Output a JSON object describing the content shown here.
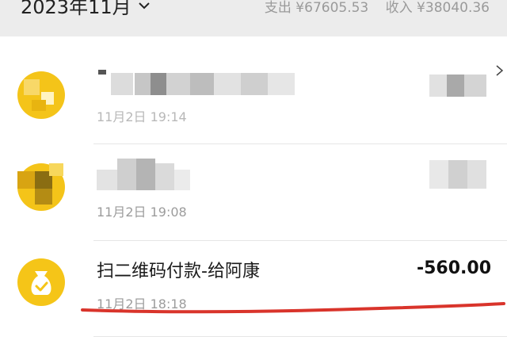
{
  "header": {
    "month_label": "2023年11月",
    "expense_label": "支出 ¥67605.53",
    "income_label": "收入 ¥38040.36"
  },
  "transactions": [
    {
      "title": "",
      "time": "11月2日 19:14",
      "amount": ""
    },
    {
      "title": "",
      "time": "11月2日 19:08",
      "amount": ""
    },
    {
      "title": "扫二维码付款-给阿康",
      "time": "11月2日  18:18",
      "amount": "-560.00"
    }
  ],
  "colors": {
    "accent_yellow": "#f5c518",
    "underline_red": "#d9342b"
  }
}
